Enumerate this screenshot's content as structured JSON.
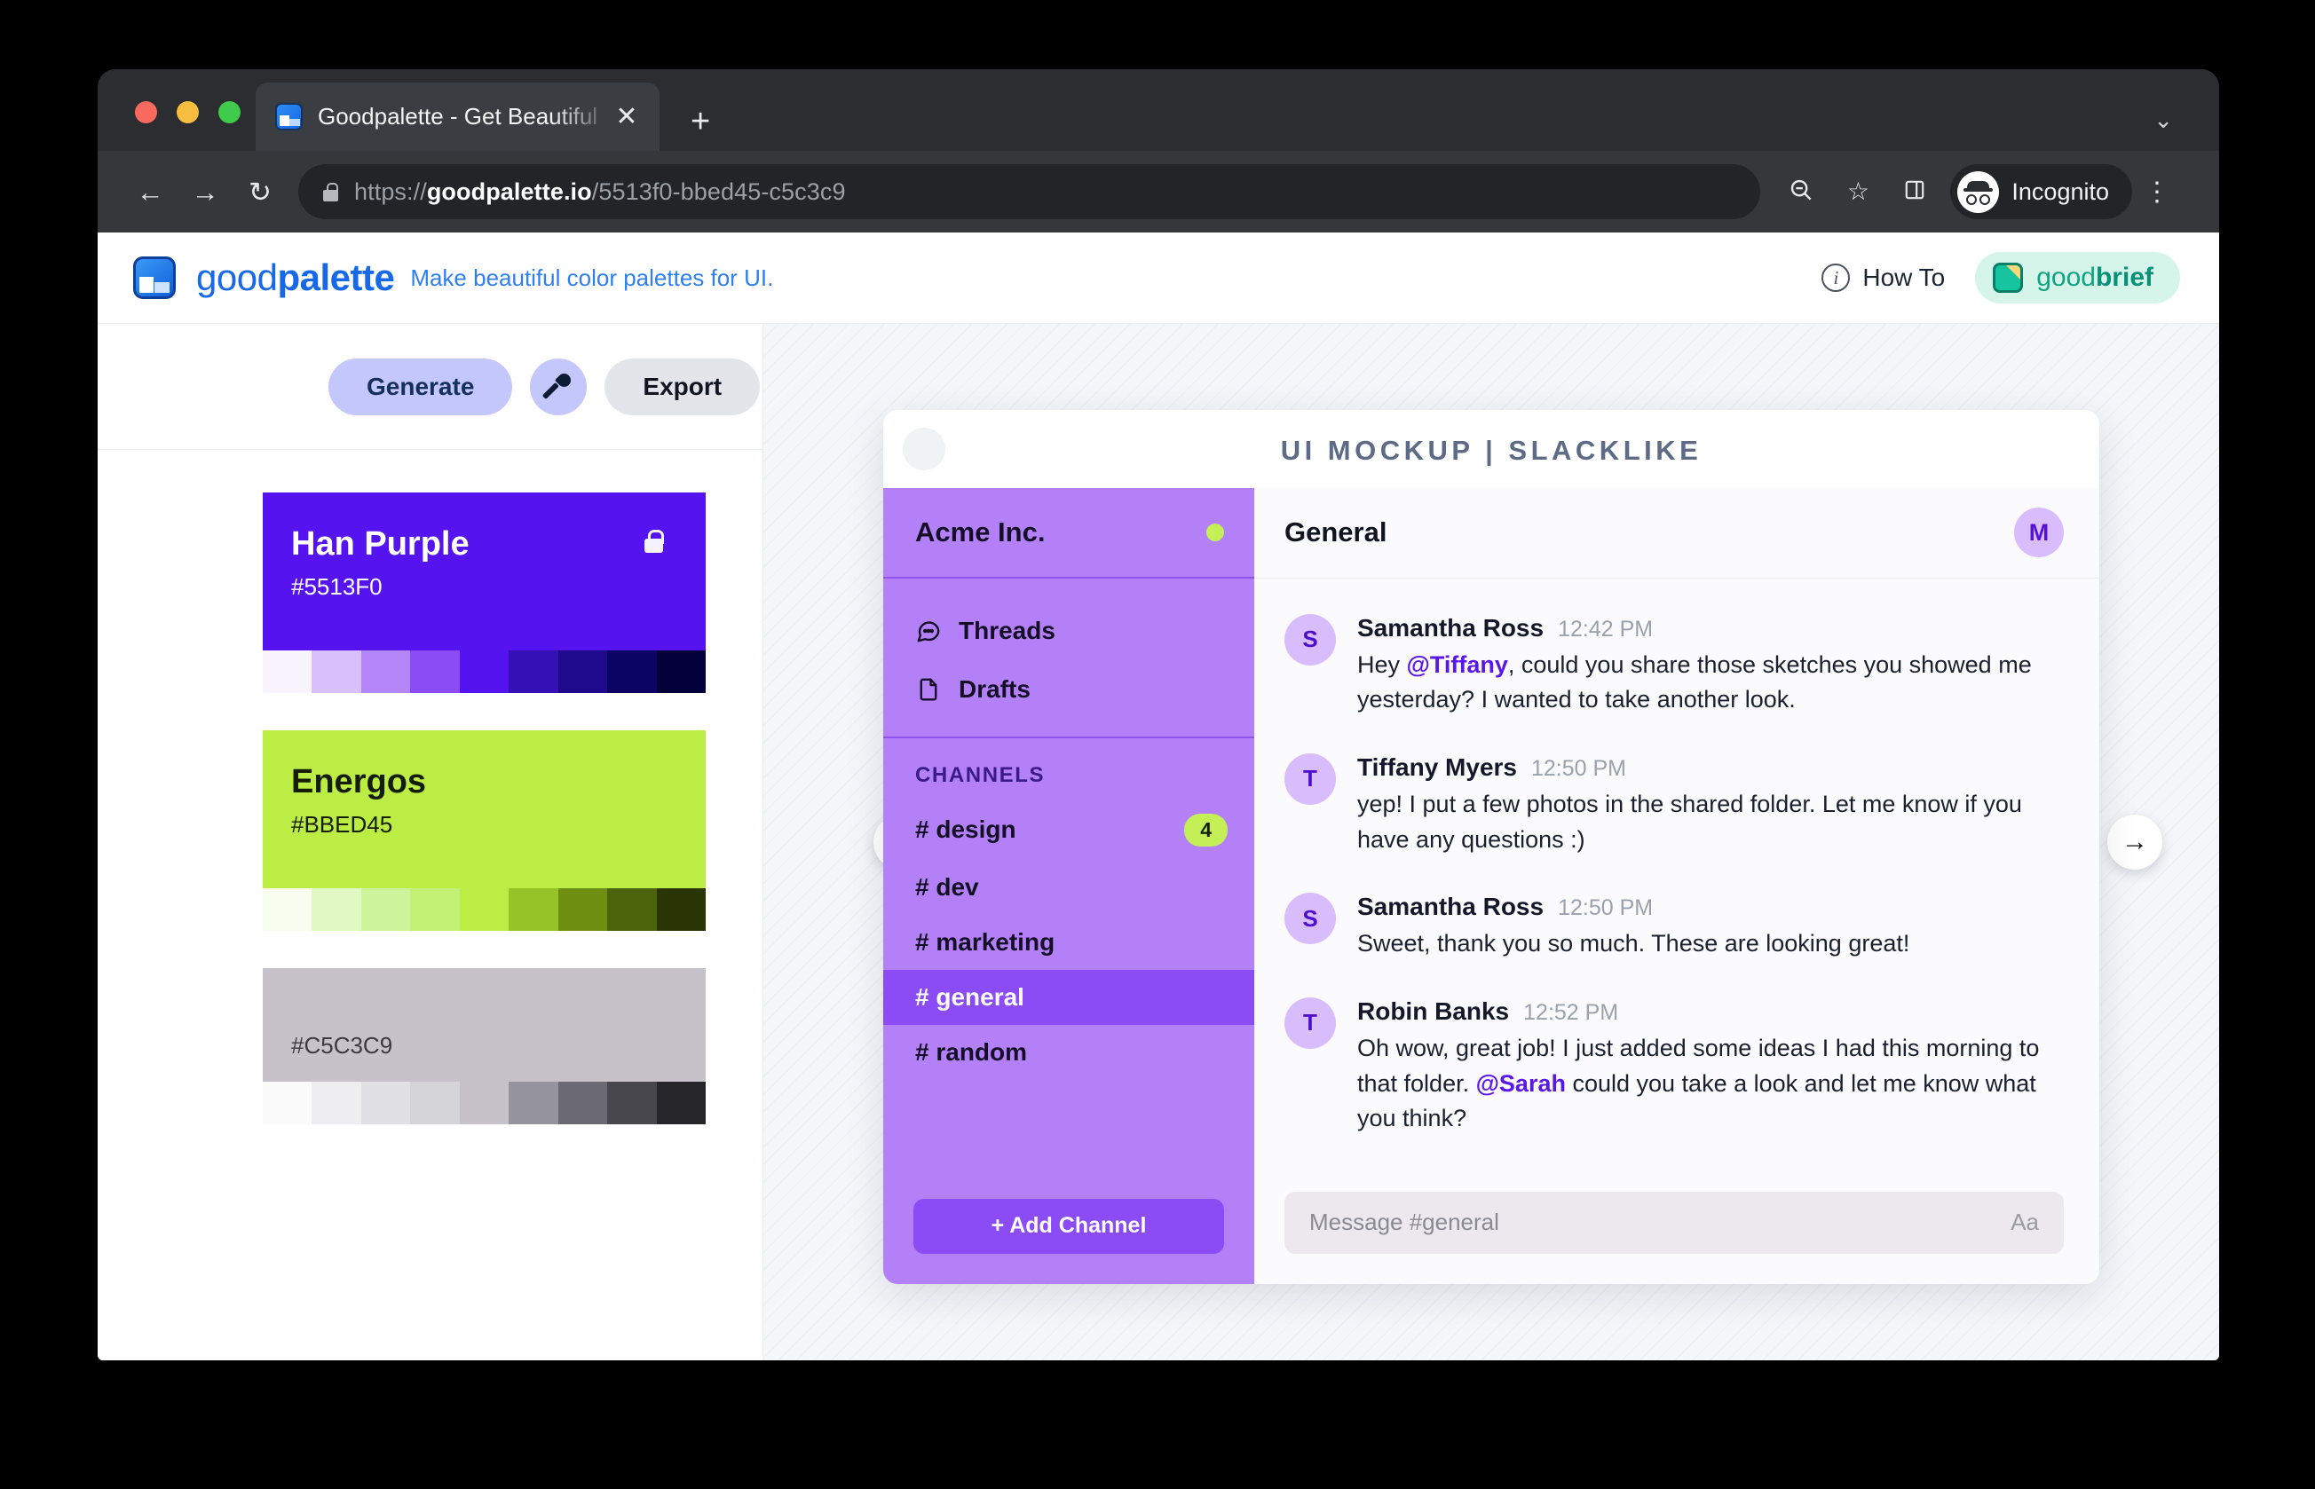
{
  "browser": {
    "tab": {
      "title": "Goodpalette - Get Beautiful Co",
      "close_label": "✕"
    },
    "new_tab_label": "+",
    "tabstrip_chevron": "⌄",
    "back_label": "←",
    "forward_label": "→",
    "reload_label": "↻",
    "url_scheme": "https://",
    "url_domain": "goodpalette.io",
    "url_path": "/5513f0-bbed45-c5c3c9",
    "zoom_out_icon": "zoom-out-icon",
    "bookmark_label": "☆",
    "side_panel_label": "▢",
    "profile_label": "Incognito",
    "menu_label": "⋮"
  },
  "header": {
    "brand_light": "good",
    "brand_bold": "palette",
    "tagline": "Make beautiful color palettes for UI.",
    "how_to": "How To",
    "info_glyph": "i",
    "goodbrief_light": "good",
    "goodbrief_bold": "brief"
  },
  "toolbar": {
    "generate_label": "Generate",
    "export_label": "Export",
    "eyedropper_name": "eyedropper-icon"
  },
  "palette": {
    "cards": [
      {
        "name": "Han Purple",
        "hex": "#5513F0",
        "base": "#5513F0",
        "text_color": "#ffffff",
        "locked": true,
        "shades": [
          "#f9f5ff",
          "#d8c0fa",
          "#b387f7",
          "#8b4bf5",
          "#5513F0",
          "#3510b4",
          "#1f0a8c",
          "#0c0463",
          "#03003a"
        ]
      },
      {
        "name": "Energos",
        "hex": "#BBED45",
        "base": "#BBED45",
        "text_color": "#161d06",
        "locked": false,
        "shades": [
          "#f9fef1",
          "#e0f8c4",
          "#cdf49b",
          "#c3f175",
          "#BBED45",
          "#96c428",
          "#6f8f13",
          "#4b630b",
          "#2a3504"
        ]
      },
      {
        "name": "",
        "hex": "#C5C3C9",
        "base": "#C5C3C9",
        "text_color": "#3a3a40",
        "locked": false,
        "shades": [
          "#fafafb",
          "#eeeef0",
          "#e1e0e4",
          "#d5d4d9",
          "#C5C3C9",
          "#95939d",
          "#6b6a74",
          "#47464d",
          "#26262a"
        ]
      }
    ]
  },
  "preview": {
    "prev_label": "←",
    "next_label": "→",
    "heading": "UI MOCKUP | SLACKLIKE",
    "sidebar": {
      "workspace": "Acme Inc.",
      "links": [
        {
          "label": "Threads",
          "icon": "chat-bubble-icon"
        },
        {
          "label": "Drafts",
          "icon": "document-icon"
        }
      ],
      "section_label": "CHANNELS",
      "channels": [
        {
          "label": "# design",
          "badge": "4",
          "active": false
        },
        {
          "label": "# dev",
          "badge": "",
          "active": false
        },
        {
          "label": "# marketing",
          "badge": "",
          "active": false
        },
        {
          "label": "# general",
          "badge": "",
          "active": true
        },
        {
          "label": "# random",
          "badge": "",
          "active": false
        }
      ],
      "add_channel": "+ Add Channel"
    },
    "channel": {
      "title": "General",
      "avatar": "M",
      "messages": [
        {
          "avatar": "S",
          "author": "Samantha Ross",
          "time": "12:42 PM",
          "parts": [
            {
              "t": "Hey ",
              "m": false
            },
            {
              "t": "@Tiffany",
              "m": true
            },
            {
              "t": ", could you share those sketches you showed me yesterday? I wanted to take another look.",
              "m": false
            }
          ]
        },
        {
          "avatar": "T",
          "author": "Tiffany Myers",
          "time": "12:50 PM",
          "parts": [
            {
              "t": "yep! I put a few photos in the shared folder. Let me know if you have any questions :)",
              "m": false
            }
          ]
        },
        {
          "avatar": "S",
          "author": "Samantha Ross",
          "time": "12:50 PM",
          "parts": [
            {
              "t": "Sweet, thank you so much. These are looking great!",
              "m": false
            }
          ]
        },
        {
          "avatar": "T",
          "author": "Robin Banks",
          "time": "12:52 PM",
          "parts": [
            {
              "t": "Oh wow, great job! I just added some ideas I had this morning to that folder. ",
              "m": false
            },
            {
              "t": "@Sarah",
              "m": true
            },
            {
              "t": " could you take a look and let me know what you think?",
              "m": false
            }
          ]
        }
      ],
      "composer_placeholder": "Message #general",
      "composer_format": "Aa"
    }
  }
}
